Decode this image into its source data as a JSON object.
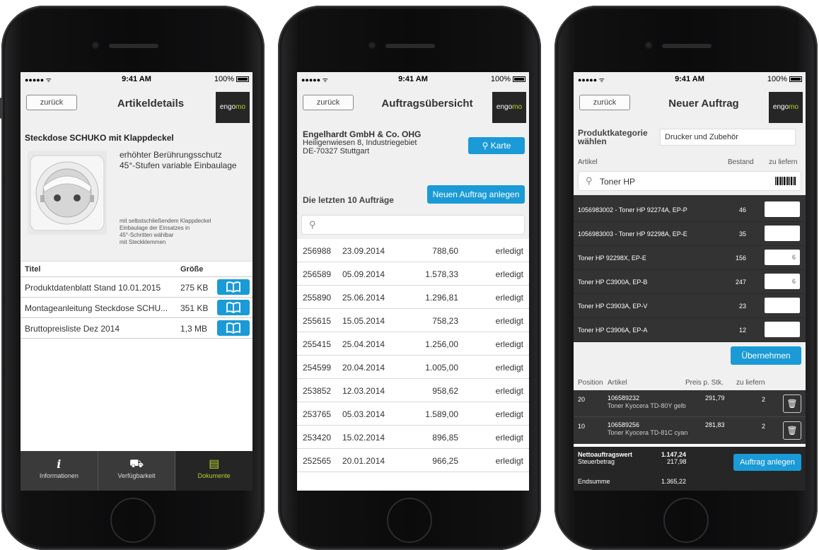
{
  "status": {
    "time": "9:41 AM",
    "battery": "100%",
    "signal": "●●●●● ᯤ"
  },
  "logo": {
    "prefix": "engo",
    "suffix": "mo"
  },
  "back_label": "zurück",
  "phone1": {
    "title": "Artikeldetails",
    "product_name": "Steckdose SCHUKO mit Klappdeckel",
    "features": [
      "erhöhter Berührungsschutz",
      "45°-Stufen variable Einbaulage"
    ],
    "description": [
      "mit selbstschließendem Klappdeckel",
      "Einbaulage der Einsatzes in",
      "45°-Schritten wählbar",
      "mit Steckklemmen"
    ],
    "table_head": {
      "title": "Titel",
      "size": "Größe"
    },
    "documents": [
      {
        "title": "Produktdatenblatt Stand 10.01.2015",
        "size": "275 KB"
      },
      {
        "title": "Montageanleitung Steckdose SCHU...",
        "size": "351 KB"
      },
      {
        "title": "Bruttopreisliste Dez 2014",
        "size": "1,3 MB"
      }
    ],
    "tabs": [
      {
        "label": "Informationen",
        "icon": "info-icon"
      },
      {
        "label": "Verfügbarkeit",
        "icon": "availability-icon"
      },
      {
        "label": "Dokumente",
        "icon": "documents-icon"
      }
    ],
    "active_tab": "Dokumente"
  },
  "phone2": {
    "title": "Auftragsübersicht",
    "company": {
      "name": "Engelhardt GmbH & Co. OHG",
      "street": "Heiligenwiesen 8, Industriegebiet",
      "city": "DE-70327 Stuttgart"
    },
    "map_button": "Karte",
    "last_orders_label": "Die letzten 10 Aufträge",
    "new_order_button": "Neuen Auftrag anlegen",
    "search_placeholder": "",
    "orders": [
      {
        "nr": "256988",
        "date": "23.09.2014",
        "amount": "788,60",
        "status": "erledigt"
      },
      {
        "nr": "256589",
        "date": "05.09.2014",
        "amount": "1.578,33",
        "status": "erledigt"
      },
      {
        "nr": "255890",
        "date": "25.06.2014",
        "amount": "1.296,81",
        "status": "erledigt"
      },
      {
        "nr": "255615",
        "date": "15.05.2014",
        "amount": "758,23",
        "status": "erledigt"
      },
      {
        "nr": "255415",
        "date": "25.04.2014",
        "amount": "1.256,00",
        "status": "erledigt"
      },
      {
        "nr": "254599",
        "date": "20.04.2014",
        "amount": "1.005,00",
        "status": "erledigt"
      },
      {
        "nr": "253852",
        "date": "12.03.2014",
        "amount": "958,62",
        "status": "erledigt"
      },
      {
        "nr": "253765",
        "date": "05.03.2014",
        "amount": "1.589,00",
        "status": "erledigt"
      },
      {
        "nr": "253420",
        "date": "15.02.2014",
        "amount": "896,85",
        "status": "erledigt"
      },
      {
        "nr": "252565",
        "date": "20.01.2014",
        "amount": "966,25",
        "status": "erledigt"
      }
    ]
  },
  "phone3": {
    "title": "Neuer Auftrag",
    "category_label_1": "Produktkategorie",
    "category_label_2": "wählen",
    "category_value": "Drucker und Zubehör",
    "col_article": "Artikel",
    "col_stock": "Bestand",
    "col_deliver": "zu liefern",
    "search_value": "Toner HP",
    "articles": [
      {
        "name": "1056983002 - Toner HP 92274A, EP-P",
        "stock": "46",
        "qty": ""
      },
      {
        "name": "1056983003 - Toner HP 92298A, EP-E",
        "stock": "35",
        "qty": ""
      },
      {
        "name": "Toner HP 92298X, EP-E",
        "stock": "156",
        "qty": "6"
      },
      {
        "name": "Toner HP C3900A, EP-B",
        "stock": "247",
        "qty": "6"
      },
      {
        "name": "Toner HP C3903A, EP-V",
        "stock": "23",
        "qty": ""
      },
      {
        "name": "Toner HP C3906A, EP-A",
        "stock": "12",
        "qty": ""
      }
    ],
    "apply_button": "Übernehmen",
    "pos_head": {
      "position": "Position",
      "article": "Artikel",
      "price": "Preis p. Stk.",
      "deliver": "zu liefern"
    },
    "positions": [
      {
        "pos": "20",
        "nr": "106589232",
        "name": "Toner Kyocera TD-80Y gelb",
        "price": "291,79",
        "qty": "2"
      },
      {
        "pos": "10",
        "nr": "106589256",
        "name": "Toner Kyocera TD-81C cyan",
        "price": "281,83",
        "qty": "2"
      }
    ],
    "summary": {
      "net_label": "Nettoauftragswert",
      "net_value": "1.147,24",
      "tax_label": "Steuerbetrag",
      "tax_value": "217,98",
      "total_label": "Endsumme",
      "total_value": "1.365,22"
    },
    "create_button": "Auftrag anlegen"
  }
}
